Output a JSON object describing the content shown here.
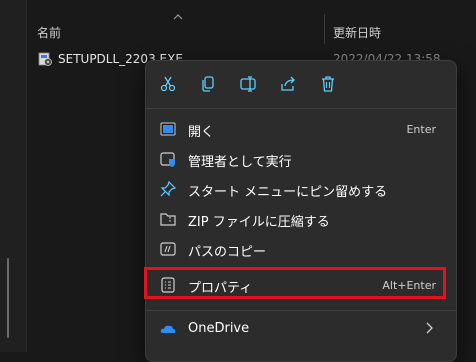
{
  "header": {
    "col_name": "名前",
    "col_date": "更新日時"
  },
  "file": {
    "name": "SETUPDLL_2203.EXE",
    "date": "2022/04/22 13:58"
  },
  "toolbar": {
    "icons": [
      "cut-icon",
      "copy-icon",
      "rename-icon",
      "share-icon",
      "delete-icon"
    ]
  },
  "menu": {
    "items": [
      {
        "label": "開く",
        "accelerator": "Enter",
        "icon": "open-icon"
      },
      {
        "label": "管理者として実行",
        "accelerator": "",
        "icon": "run-as-admin-icon"
      },
      {
        "label": "スタート メニューにピン留めする",
        "accelerator": "",
        "icon": "pin-icon"
      },
      {
        "label": "ZIP ファイルに圧縮する",
        "accelerator": "",
        "icon": "zip-icon"
      },
      {
        "label": "パスのコピー",
        "accelerator": "",
        "icon": "copy-path-icon"
      },
      {
        "label": "プロパティ",
        "accelerator": "Alt+Enter",
        "icon": "properties-icon",
        "highlighted": true
      },
      {
        "label": "OneDrive",
        "accelerator": "",
        "icon": "onedrive-icon",
        "submenu": true
      }
    ]
  },
  "colors": {
    "highlight": "#e0131f",
    "accent": "#60cdff",
    "menu_bg": "#2c2c2c"
  }
}
